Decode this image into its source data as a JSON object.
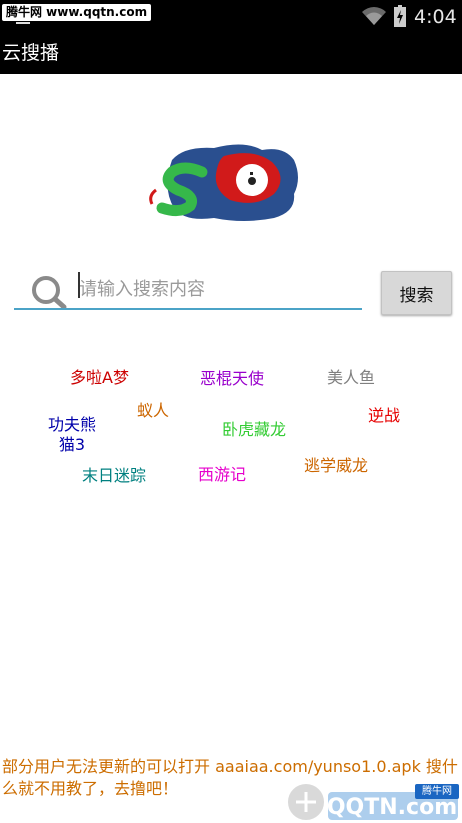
{
  "status_bar": {
    "watermark": "腾牛网 www.qqtn.com",
    "time": "4:04"
  },
  "action_bar": {
    "title": "云搜播"
  },
  "search": {
    "placeholder": "请输入搜索内容",
    "button_label": "搜索"
  },
  "hot_tags": [
    {
      "label": "多啦A梦",
      "color": "#cc0000"
    },
    {
      "label": "恶棍天使",
      "color": "#9900cc"
    },
    {
      "label": "美人鱼",
      "color": "#808080"
    },
    {
      "label": "蚁人",
      "color": "#cc6600"
    },
    {
      "label": "逆战",
      "color": "#e60000"
    },
    {
      "label": "功夫熊\n猫3",
      "color": "#0000aa"
    },
    {
      "label": "卧虎藏龙",
      "color": "#33cc33"
    },
    {
      "label": "逃学威龙",
      "color": "#cc6600"
    },
    {
      "label": "末日迷踪",
      "color": "#008080"
    },
    {
      "label": "西游记",
      "color": "#e600cc"
    }
  ],
  "footer": {
    "notice": "部分用户无法更新的可以打开 aaaiaa.com/yunso1.0.apk 搜什么就不用教了，去撸吧！",
    "watermark_logo": "QQTN.com",
    "watermark_badge": "腾牛网"
  }
}
